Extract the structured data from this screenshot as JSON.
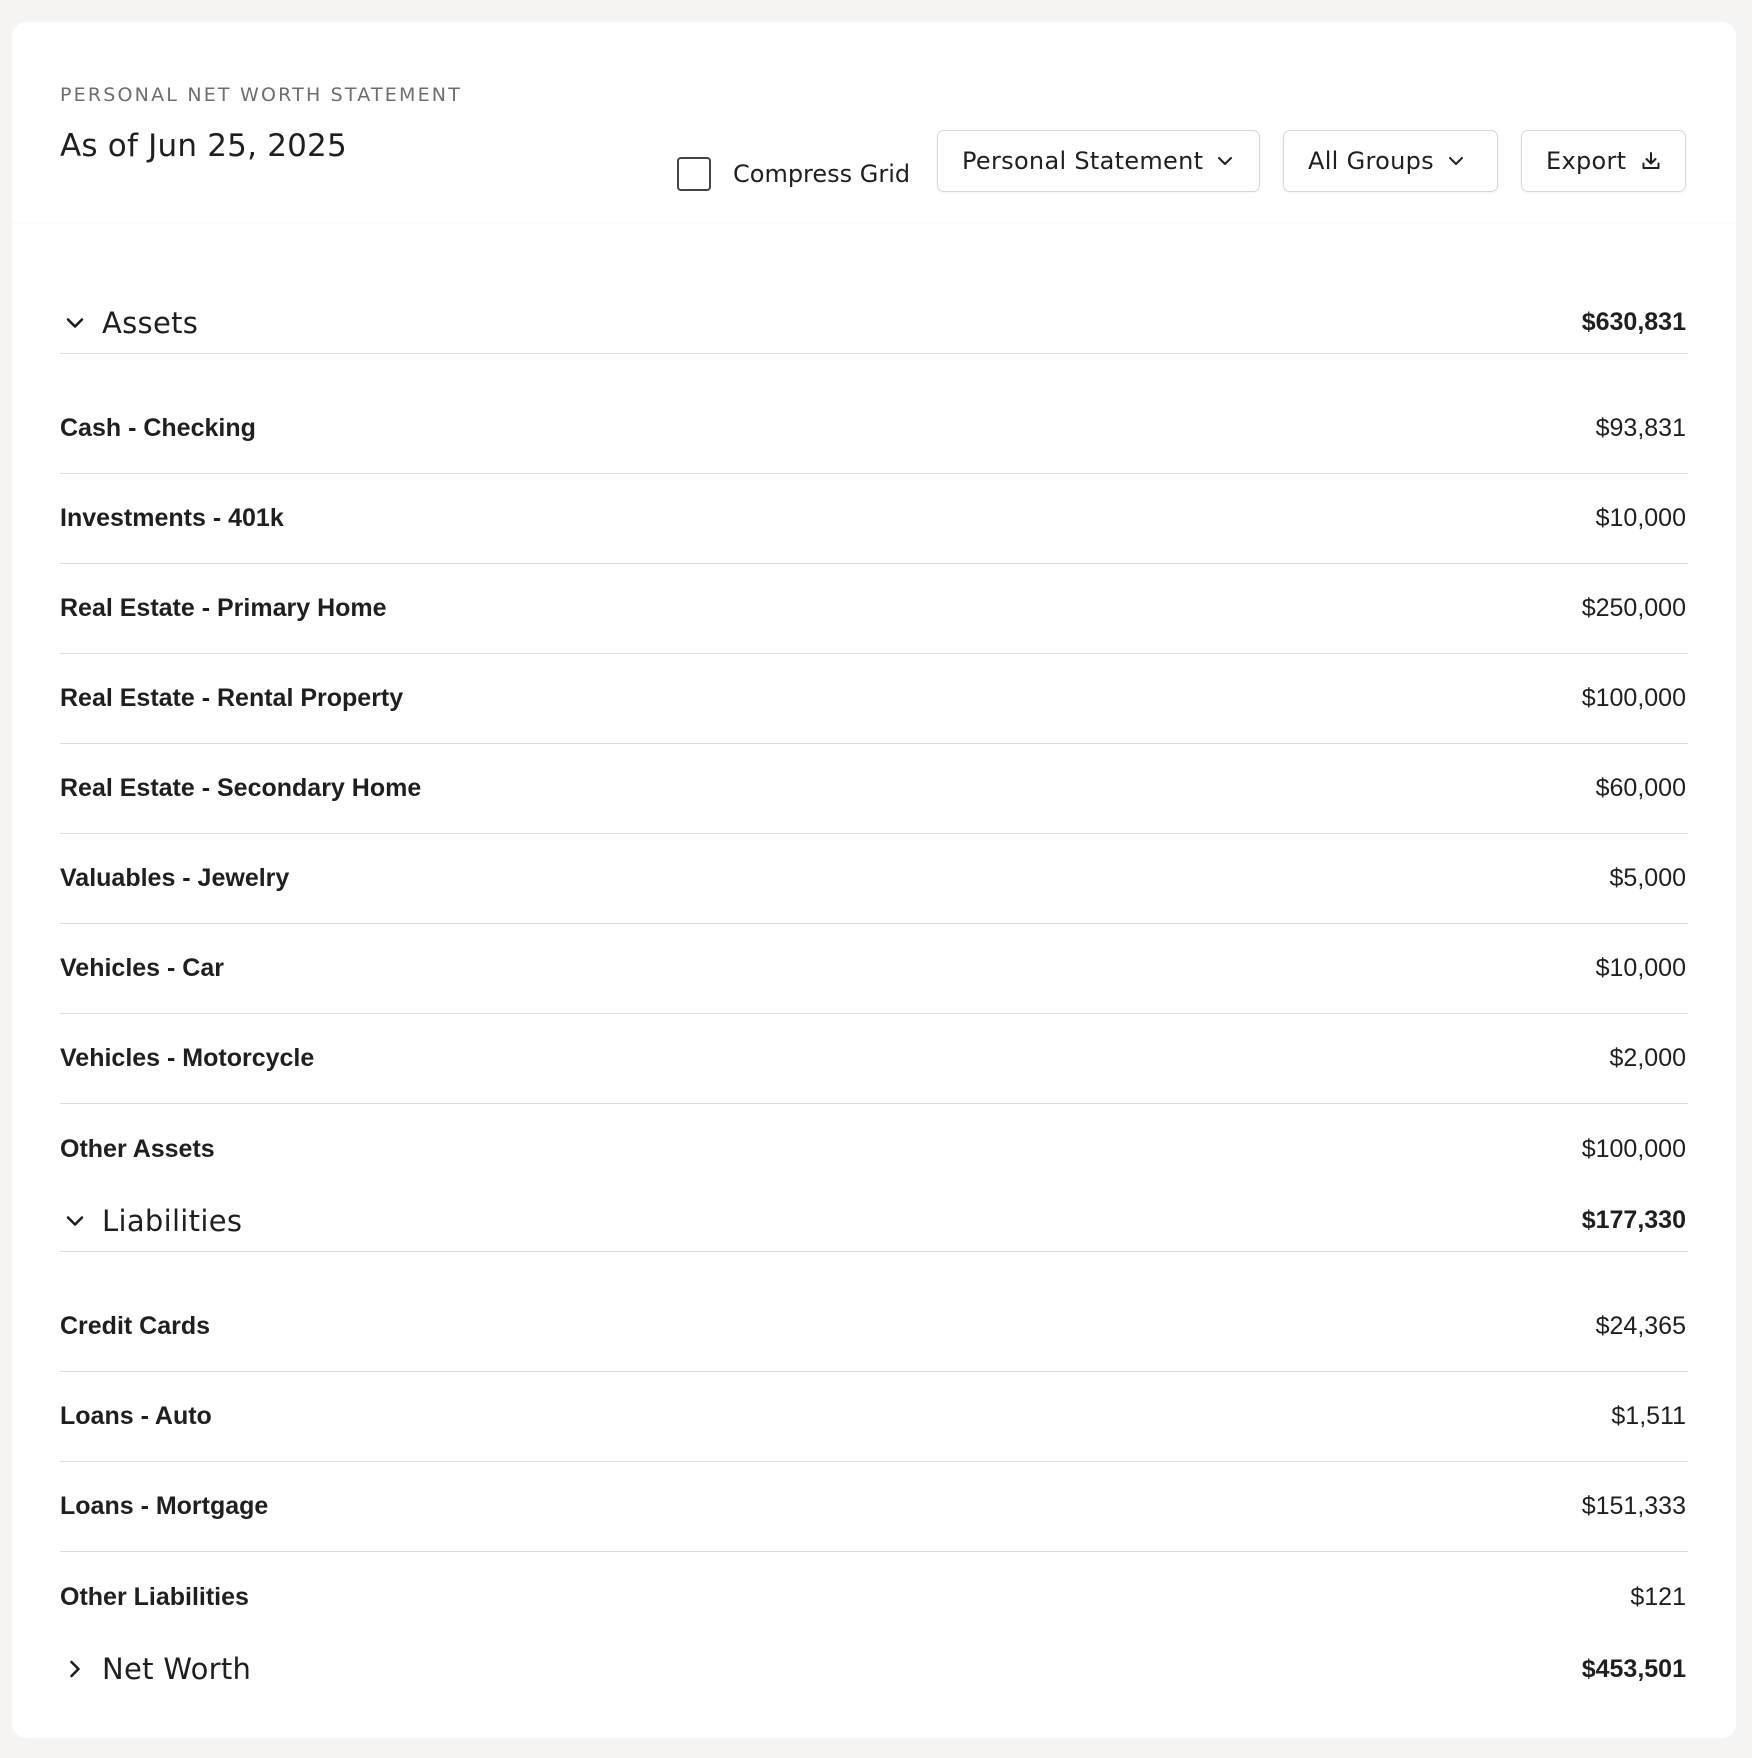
{
  "header": {
    "kicker": "PERSONAL NET WORTH STATEMENT",
    "as_of": "As of Jun 25, 2025",
    "compress_label": "Compress Grid",
    "compress_checked": false,
    "statement_select": "Personal Statement",
    "groups_select": "All Groups",
    "export_label": "Export"
  },
  "assets": {
    "title": "Assets",
    "total": "$630,831",
    "expanded": true,
    "items": [
      {
        "name": "Cash - Checking",
        "value": "$93,831"
      },
      {
        "name": "Investments - 401k",
        "value": "$10,000"
      },
      {
        "name": "Real Estate - Primary Home",
        "value": "$250,000"
      },
      {
        "name": "Real Estate - Rental Property",
        "value": "$100,000"
      },
      {
        "name": "Real Estate - Secondary Home",
        "value": "$60,000"
      },
      {
        "name": "Valuables - Jewelry",
        "value": "$5,000"
      },
      {
        "name": "Vehicles - Car",
        "value": "$10,000"
      },
      {
        "name": "Vehicles - Motorcycle",
        "value": "$2,000"
      },
      {
        "name": "Other Assets",
        "value": "$100,000"
      }
    ]
  },
  "liabilities": {
    "title": "Liabilities",
    "total": "$177,330",
    "expanded": true,
    "items": [
      {
        "name": "Credit Cards",
        "value": "$24,365"
      },
      {
        "name": "Loans - Auto",
        "value": "$1,511"
      },
      {
        "name": "Loans - Mortgage",
        "value": "$151,333"
      },
      {
        "name": "Other Liabilities",
        "value": "$121"
      }
    ]
  },
  "net_worth": {
    "title": "Net Worth",
    "total": "$453,501",
    "expanded": false
  },
  "icons": {
    "assets_caret": "chevron-down-icon",
    "liabilities_caret": "chevron-down-icon",
    "net_worth_caret": "chevron-right-icon",
    "export_icon": "download-icon"
  }
}
